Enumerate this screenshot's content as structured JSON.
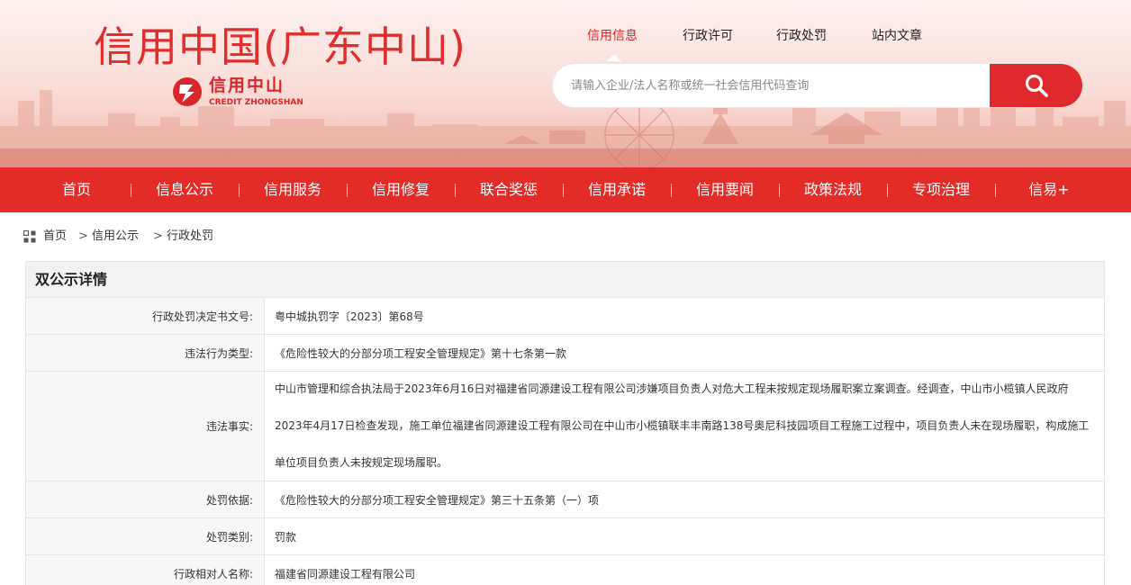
{
  "header": {
    "site_title": "信用中国(广东中山)",
    "logo": {
      "cn": "信用中山",
      "en": "CREDIT ZHONGSHAN"
    },
    "top_links": [
      "信用信息",
      "行政许可",
      "行政处罚",
      "站内文章"
    ],
    "active_top_link": "信用信息",
    "search": {
      "placeholder": "请输入企业/法人名称或统一社会信用代码查询",
      "value": ""
    }
  },
  "nav": {
    "items": [
      "首页",
      "信息公示",
      "信用服务",
      "信用修复",
      "联合奖惩",
      "信用承诺",
      "信用要闻",
      "政策法规",
      "专项治理",
      "信易+"
    ]
  },
  "breadcrumb": [
    "首页",
    "信用公示",
    "行政处罚"
  ],
  "detail": {
    "title": "双公示详情",
    "rows": [
      {
        "label": "行政处罚决定书文号:",
        "value": "粤中城执罚字〔2023〕第68号"
      },
      {
        "label": "违法行为类型:",
        "value": "《危险性较大的分部分项工程安全管理规定》第十七条第一款"
      },
      {
        "label": "违法事实:",
        "value": "中山市管理和综合执法局于2023年6月16日对福建省同源建设工程有限公司涉嫌项目负责人对危大工程未按规定现场履职案立案调查。经调查，中山市小榄镇人民政府2023年4月17日检查发现，施工单位福建省同源建设工程有限公司在中山市小榄镇联丰丰南路138号奥尼科技园项目工程施工过程中，项目负责人未在现场履职，构成施工单位项目负责人未按规定现场履职。"
      },
      {
        "label": "处罚依据:",
        "value": "《危险性较大的分部分项工程安全管理规定》第三十五条第（一）项"
      },
      {
        "label": "处罚类别:",
        "value": "罚款"
      },
      {
        "label": "行政相对人名称:",
        "value": "福建省同源建设工程有限公司"
      }
    ]
  },
  "colors": {
    "brand_red": "#e32b27",
    "title_red": "#e02d2d",
    "label_bg": "#f7f7f7",
    "border": "#e4e4e4"
  },
  "icons": [
    "logo-mark-icon",
    "search-icon",
    "grid-icon"
  ]
}
